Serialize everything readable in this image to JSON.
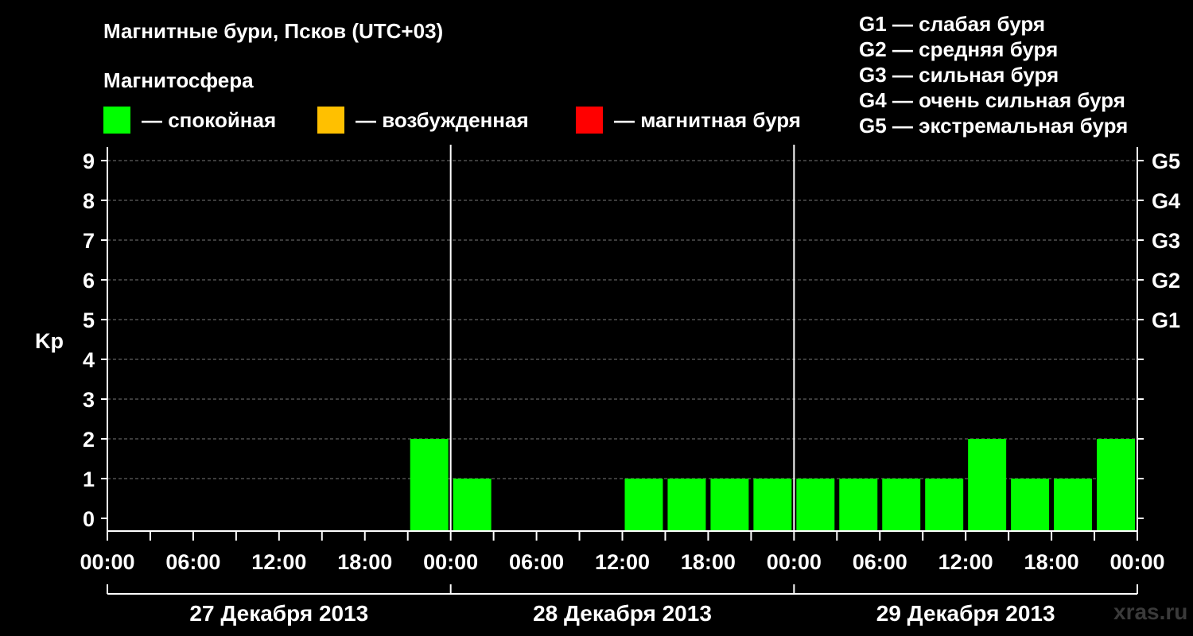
{
  "page": {
    "title": "Магнитные бури, Псков (UTC+03)",
    "subtitle": "Магнитосфера",
    "watermark": "xras.ru"
  },
  "legend": {
    "calm": {
      "label": "— спокойная",
      "color": "#00ff00"
    },
    "excited": {
      "label": "— возбужденная",
      "color": "#ffc000"
    },
    "storm": {
      "label": "— магнитная буря",
      "color": "#ff0000"
    }
  },
  "g_legend": [
    "G1 — слабая буря",
    "G2 — средняя буря",
    "G3 — сильная буря",
    "G4 — очень сильная буря",
    "G5 — экстремальная буря"
  ],
  "chart_data": {
    "type": "bar",
    "ylabel": "Kp",
    "ylim": [
      0,
      9
    ],
    "yticks": [
      0,
      1,
      2,
      3,
      4,
      5,
      6,
      7,
      8,
      9
    ],
    "right_ticks": [
      {
        "value": 5,
        "label": "G1"
      },
      {
        "value": 6,
        "label": "G2"
      },
      {
        "value": 7,
        "label": "G3"
      },
      {
        "value": 8,
        "label": "G4"
      },
      {
        "value": 9,
        "label": "G5"
      }
    ],
    "x_tick_labels": [
      "00:00",
      "06:00",
      "12:00",
      "18:00",
      "00:00",
      "06:00",
      "12:00",
      "18:00",
      "00:00",
      "06:00",
      "12:00",
      "18:00",
      "00:00"
    ],
    "days": [
      "27 Декабря 2013",
      "28 Декабря 2013",
      "29 Декабря 2013"
    ],
    "interval_hours": 3,
    "values": [
      null,
      null,
      null,
      null,
      null,
      null,
      null,
      2,
      1,
      null,
      null,
      null,
      1,
      1,
      1,
      1,
      1,
      1,
      1,
      1,
      2,
      1,
      1,
      2
    ],
    "bar_color": "#00ff00",
    "grid": true
  }
}
